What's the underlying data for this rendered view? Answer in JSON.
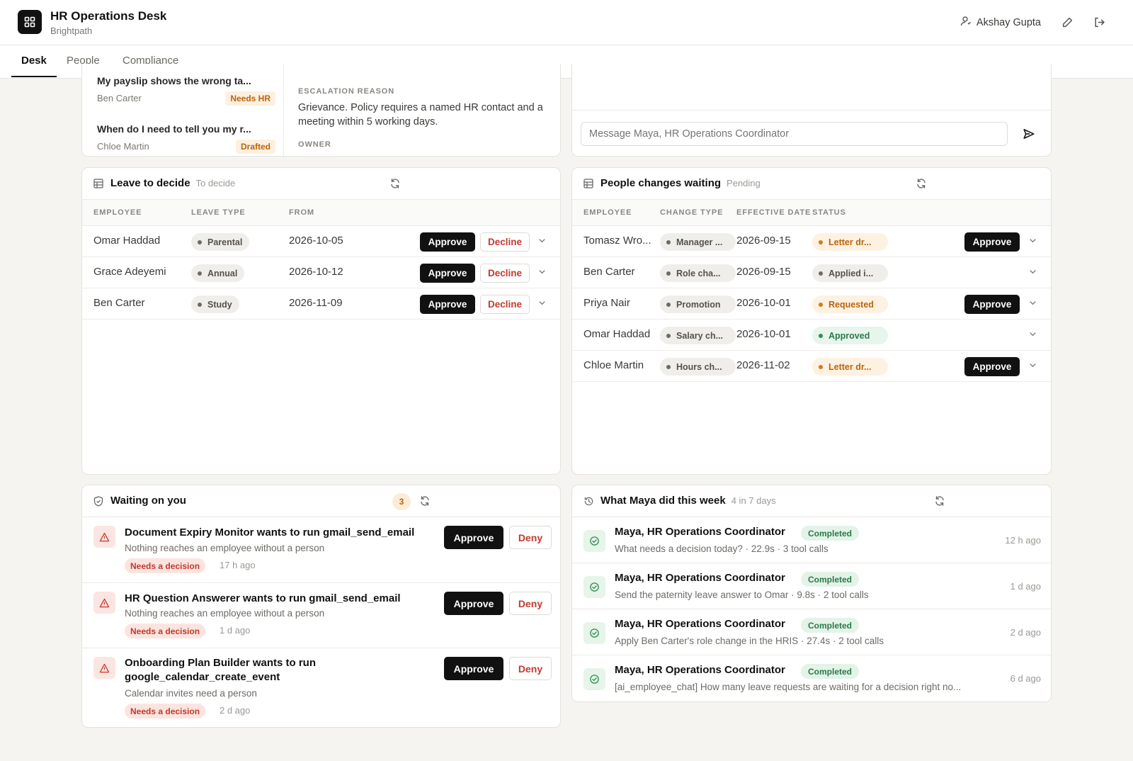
{
  "header": {
    "title": "HR Operations Desk",
    "subtitle": "Brightpath",
    "user": "Akshay Gupta"
  },
  "tabs": [
    "Desk",
    "People",
    "Compliance"
  ],
  "tickets": [
    {
      "title": "My payslip shows the wrong ta...",
      "who": "Ben Carter",
      "badge": "Needs HR"
    },
    {
      "title": "When do I need to tell you my r...",
      "who": "Chloe Martin",
      "badge": "Drafted"
    }
  ],
  "escalation": {
    "reason_label": "ESCALATION REASON",
    "reason_text": "Grievance. Policy requires a named HR contact and a meeting within 5 working days.",
    "owner_label": "OWNER"
  },
  "chat": {
    "placeholder": "Message Maya, HR Operations Coordinator"
  },
  "leave": {
    "title": "Leave to decide",
    "subtitle": "To decide",
    "columns": [
      "EMPLOYEE",
      "LEAVE TYPE",
      "FROM"
    ],
    "approve_label": "Approve",
    "decline_label": "Decline",
    "rows": [
      {
        "employee": "Omar Haddad",
        "type": "Parental",
        "from": "2026-10-05"
      },
      {
        "employee": "Grace Adeyemi",
        "type": "Annual",
        "from": "2026-10-12"
      },
      {
        "employee": "Ben Carter",
        "type": "Study",
        "from": "2026-11-09"
      }
    ]
  },
  "changes": {
    "title": "People changes waiting",
    "subtitle": "Pending",
    "columns": [
      "EMPLOYEE",
      "CHANGE TYPE",
      "EFFECTIVE DATE",
      "STATUS"
    ],
    "approve_label": "Approve",
    "rows": [
      {
        "employee": "Tomasz Wro...",
        "type": "Manager ...",
        "date": "2026-09-15",
        "status": "Letter dr...",
        "tone": "amber",
        "approve": true
      },
      {
        "employee": "Ben Carter",
        "type": "Role cha...",
        "date": "2026-09-15",
        "status": "Applied i...",
        "tone": "grey",
        "approve": false
      },
      {
        "employee": "Priya Nair",
        "type": "Promotion",
        "date": "2026-10-01",
        "status": "Requested",
        "tone": "amber",
        "approve": true
      },
      {
        "employee": "Omar Haddad",
        "type": "Salary ch...",
        "date": "2026-10-01",
        "status": "Approved",
        "tone": "green",
        "approve": false
      },
      {
        "employee": "Chloe Martin",
        "type": "Hours ch...",
        "date": "2026-11-02",
        "status": "Letter dr...",
        "tone": "amber",
        "approve": true
      }
    ]
  },
  "waiting": {
    "title": "Waiting on you",
    "count": "3",
    "approve_label": "Approve",
    "deny_label": "Deny",
    "items": [
      {
        "title": "Document Expiry Monitor wants to run gmail_send_email",
        "desc": "Nothing reaches an employee without a person",
        "badge": "Needs a decision",
        "ago": "17 h ago"
      },
      {
        "title": "HR Question Answerer wants to run gmail_send_email",
        "desc": "Nothing reaches an employee without a person",
        "badge": "Needs a decision",
        "ago": "1 d ago"
      },
      {
        "title": "Onboarding Plan Builder wants to run google_calendar_create_event",
        "desc": "Calendar invites need a person",
        "badge": "Needs a decision",
        "ago": "2 d ago"
      }
    ]
  },
  "activity": {
    "title": "What Maya did this week",
    "subtitle": "4 in 7 days",
    "items": [
      {
        "who": "Maya, HR Operations Coordinator",
        "badge": "Completed",
        "desc": "What needs a decision today? · 22.9s · 3 tool calls",
        "ago": "12 h ago"
      },
      {
        "who": "Maya, HR Operations Coordinator",
        "badge": "Completed",
        "desc": "Send the paternity leave answer to Omar · 9.8s · 2 tool calls",
        "ago": "1 d ago"
      },
      {
        "who": "Maya, HR Operations Coordinator",
        "badge": "Completed",
        "desc": "Apply Ben Carter's role change in the HRIS · 27.4s · 2 tool calls",
        "ago": "2 d ago"
      },
      {
        "who": "Maya, HR Operations Coordinator",
        "badge": "Completed",
        "desc": "[ai_employee_chat] How many leave requests are waiting for a decision right no...",
        "ago": "6 d ago"
      }
    ]
  },
  "icons": {
    "logo": "grid-icon",
    "user": "user-icon",
    "edit": "pencil-icon",
    "logout": "logout-icon",
    "table": "table-icon",
    "refresh": "refresh-icon",
    "shield": "shield-check-icon",
    "history": "history-icon",
    "warning": "warning-icon",
    "check": "check-circle-icon",
    "send": "send-icon",
    "chevron": "chevron-down-icon"
  },
  "colors": {
    "accent": "#111111",
    "amber": "#d67915",
    "green": "#2f8f52",
    "danger": "#c43a2f"
  }
}
